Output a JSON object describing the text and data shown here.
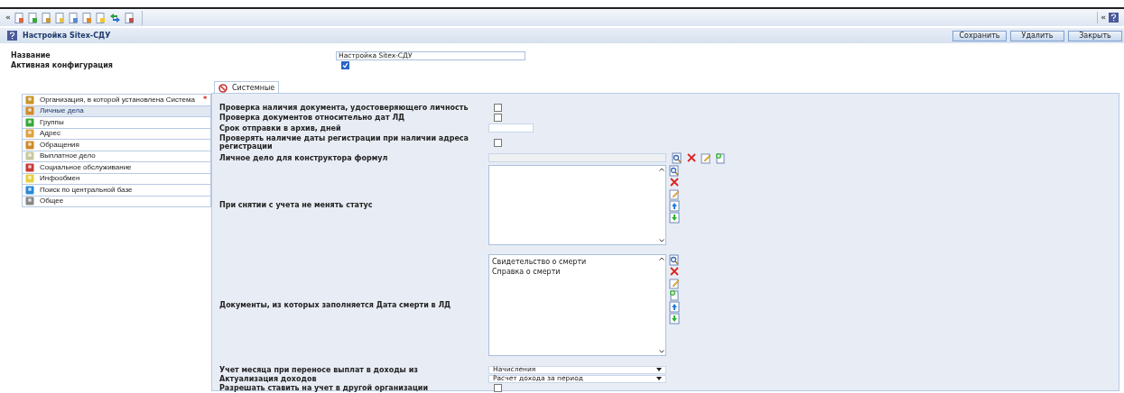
{
  "toolbar": {
    "collapse_glyph": "«",
    "expand_glyph": "«"
  },
  "header": {
    "title": "Настройка Sitex-СДУ",
    "buttons": [
      "Сохранить",
      "Удалить",
      "Закрыть"
    ]
  },
  "form": {
    "name": {
      "label": "Название",
      "value": "Настройка Sitex-СДУ"
    },
    "active": {
      "label": "Активная конфигурация",
      "checked": true
    }
  },
  "tabs": [
    {
      "label": "Системные",
      "selected": true
    }
  ],
  "sidebar": {
    "items": [
      {
        "label": "Организация, в которой установлена Система",
        "selected": false,
        "required_mark": "*"
      },
      {
        "label": "Личные дела",
        "selected": true
      },
      {
        "label": "Группы",
        "selected": false
      },
      {
        "label": "Адрес",
        "selected": false
      },
      {
        "label": "Обращения",
        "selected": false
      },
      {
        "label": "Выплатное дело",
        "selected": false
      },
      {
        "label": "Социальное обслуживание",
        "selected": false
      },
      {
        "label": "Инфообмен",
        "selected": false
      },
      {
        "label": "Поиск по центральной базе",
        "selected": false
      },
      {
        "label": "Общее",
        "selected": false
      }
    ]
  },
  "settings": [
    {
      "kind": "checkbox",
      "label": "Проверка наличия документа, удостоверяющего личность",
      "checked": false
    },
    {
      "kind": "checkbox",
      "label": "Проверка документов относительно дат ЛД",
      "checked": false
    },
    {
      "kind": "text",
      "label": "Срок отправки в архив, дней"
    },
    {
      "kind": "checkbox",
      "label": "Проверять наличие даты регистрации при наличии адреса регистрации",
      "checked": false
    },
    {
      "kind": "picker",
      "label": "Личное дело для конструктора формул"
    },
    {
      "kind": "list",
      "label": "При снятии с учета не менять статус",
      "add_button": false
    },
    {
      "kind": "list",
      "label": "Документы, из которых заполняется Дата смерти в ЛД",
      "add_button": true,
      "items": [
        "Свидетельство о смерти",
        "Справка о смерти"
      ]
    },
    {
      "kind": "select",
      "label": "Учет месяца при переносе выплат в доходы из",
      "value": "Начисления"
    },
    {
      "kind": "select",
      "label": "Актуализация доходов",
      "value": "Расчет дохода за период"
    },
    {
      "kind": "checkbox",
      "label": "Разрешать ставить на учет в другой организации",
      "checked": false
    }
  ]
}
